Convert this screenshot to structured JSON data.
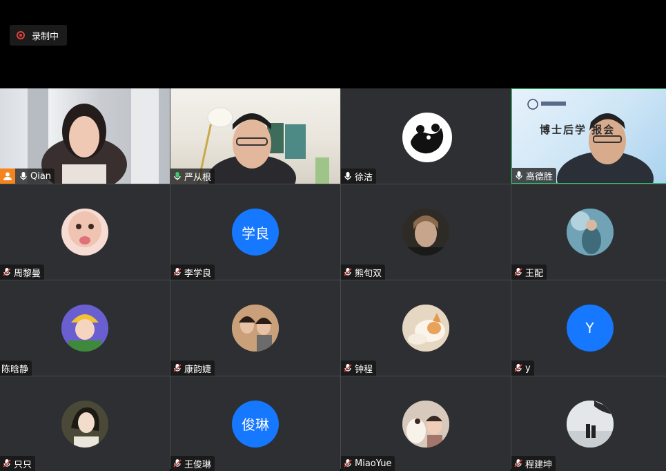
{
  "recording": {
    "label": "录制中"
  },
  "tiles": [
    {
      "name": "Qian",
      "mic": "on",
      "host": true
    },
    {
      "name": "严从根",
      "mic": "on-green"
    },
    {
      "name": "徐洁",
      "mic": "on"
    },
    {
      "name": "高德胜",
      "mic": "on"
    },
    {
      "name": "周黎曼",
      "mic": "muted"
    },
    {
      "name": "李学良",
      "mic": "muted",
      "avatar_text": "学良"
    },
    {
      "name": "熊旬双",
      "mic": "muted"
    },
    {
      "name": "王配",
      "mic": "muted"
    },
    {
      "name": "陈晗静",
      "mic": "none"
    },
    {
      "name": "康韵婕",
      "mic": "muted"
    },
    {
      "name": "钟程",
      "mic": "muted"
    },
    {
      "name": "y",
      "mic": "muted",
      "avatar_text": "Y"
    },
    {
      "name": "只只",
      "mic": "muted"
    },
    {
      "name": "王俊琳",
      "mic": "muted",
      "avatar_text": "俊琳"
    },
    {
      "name": "MiaoYue",
      "mic": "muted"
    },
    {
      "name": "程建坤",
      "mic": "muted"
    }
  ],
  "banner": {
    "text": "博士后学   报会"
  },
  "colors": {
    "accent": "#1677ff",
    "record": "#e0413a",
    "active_speaker": "#2ec86a",
    "host_badge": "#f5841f"
  }
}
